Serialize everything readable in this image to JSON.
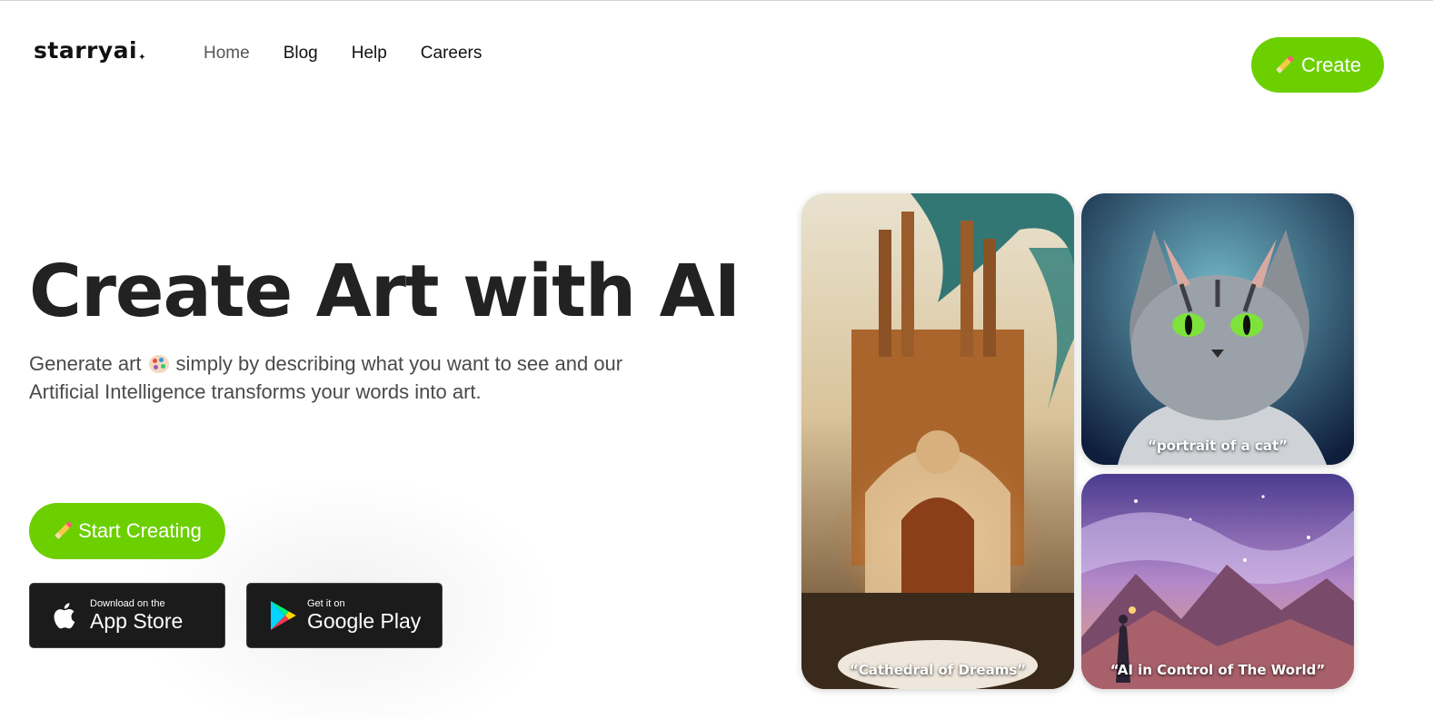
{
  "header": {
    "logo": "starryai",
    "nav": [
      "Home",
      "Blog",
      "Help",
      "Careers"
    ],
    "create_label": "Create"
  },
  "hero": {
    "title": "Create Art with AI",
    "subtitle_part1": "Generate art",
    "subtitle_part2": "simply by describing what you want to see and our Artificial Intelligence transforms your words into art.",
    "start_label": "Start Creating"
  },
  "stores": {
    "apple_small": "Download on the",
    "apple_big": "App Store",
    "google_small": "Get it on",
    "google_big": "Google Play"
  },
  "gallery": {
    "cathedral_caption": "“Cathedral of Dreams”",
    "cat_caption": "“portrait of a cat”",
    "world_caption": "“AI in Control of The World”"
  },
  "colors": {
    "accent": "#6ccf00",
    "store_bg": "#1b1b1b"
  }
}
